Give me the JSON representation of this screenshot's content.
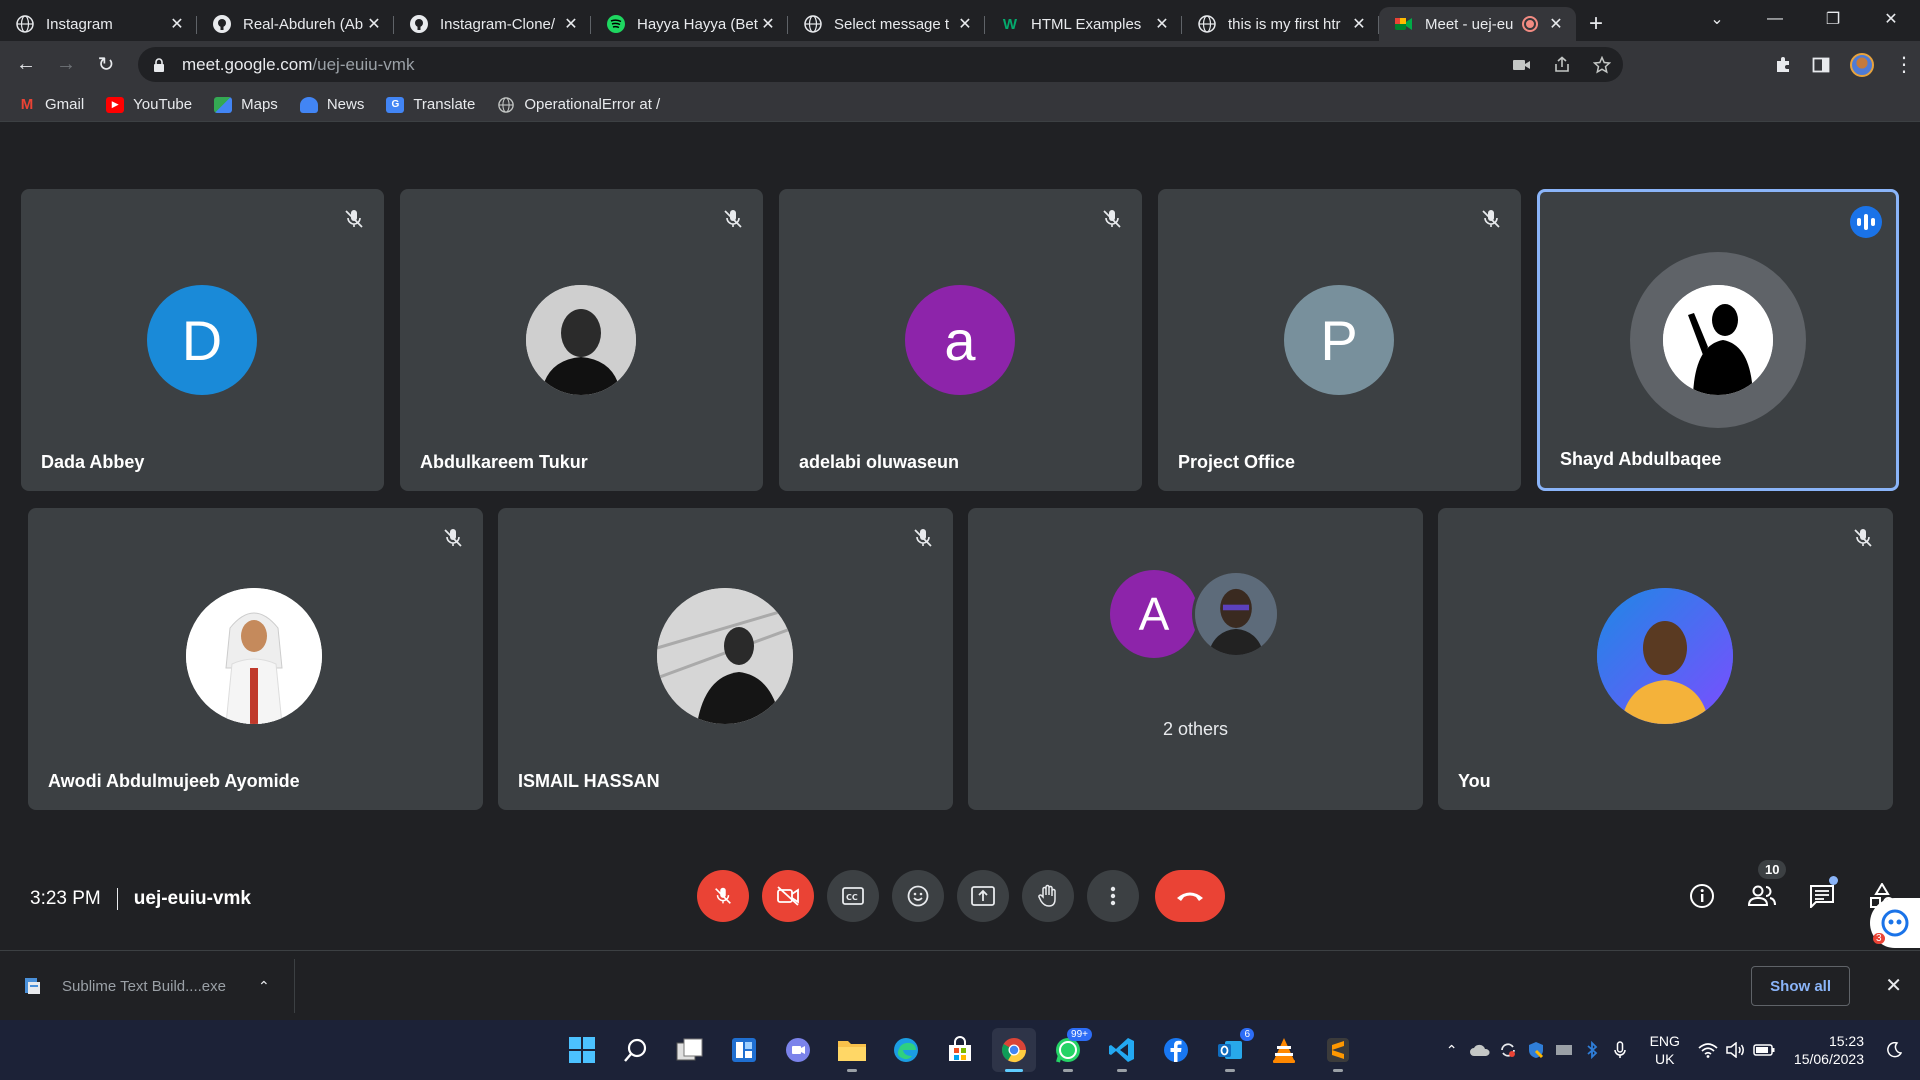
{
  "tabs": [
    {
      "title": "Instagram",
      "icon": "globe-icon"
    },
    {
      "title": "Real-Abdureh (Ab",
      "icon": "github-icon"
    },
    {
      "title": "Instagram-Clone/",
      "icon": "github-icon"
    },
    {
      "title": "Hayya Hayya (Bet",
      "icon": "spotify-icon"
    },
    {
      "title": "Select message t",
      "icon": "globe-icon"
    },
    {
      "title": "HTML Examples",
      "icon": "w3schools-icon"
    },
    {
      "title": "this is my first htr",
      "icon": "globe-icon"
    },
    {
      "title": "Meet - uej-eu",
      "icon": "google-meet-icon",
      "active": true
    }
  ],
  "address": {
    "host": "meet.google.com",
    "path": "/uej-euiu-vmk"
  },
  "bookmarks": [
    {
      "label": "Gmail",
      "icon": "gmail-icon",
      "color": "#ea4335"
    },
    {
      "label": "YouTube",
      "icon": "youtube-icon",
      "color": "#ff0000"
    },
    {
      "label": "Maps",
      "icon": "maps-icon",
      "color": "#34a853"
    },
    {
      "label": "News",
      "icon": "news-icon",
      "color": "#4285f4"
    },
    {
      "label": "Translate",
      "icon": "translate-icon",
      "color": "#4285f4"
    },
    {
      "label": "OperationalError at /",
      "icon": "globe-icon",
      "color": "#9aa0a6"
    }
  ],
  "participants": [
    {
      "name": "Dada Abbey",
      "initial": "D",
      "color": "#1a8ad8"
    },
    {
      "name": "Abdulkareem Tukur",
      "initial": "",
      "color": "#2a2a2a"
    },
    {
      "name": "adelabi oluwaseun",
      "initial": "a",
      "color": "#8d24aa"
    },
    {
      "name": "Project Office",
      "initial": "P",
      "color": "#78909c"
    },
    {
      "name": "Shayd Abdulbaqee",
      "initial": "",
      "color": "#ffffff"
    },
    {
      "name": "Awodi Abdulmujeeb Ayomide",
      "initial": "",
      "color": "#ffffff"
    },
    {
      "name": "ISMAIL HASSAN",
      "initial": "",
      "color": "#d0d0d0"
    },
    {
      "name": "2 others",
      "initial": "A",
      "color": "#8d24aa"
    },
    {
      "name": "You",
      "initial": "",
      "color": "#2979ff"
    }
  ],
  "meeting": {
    "time": "3:23 PM",
    "code": "uej-euiu-vmk",
    "people_count": "10"
  },
  "download": {
    "file": "Sublime Text Build....exe",
    "show_all": "Show all"
  },
  "taskbar": {
    "whatsapp_badge": "99+",
    "outlook_badge": "6",
    "lang_top": "ENG",
    "lang_bottom": "UK",
    "time": "15:23",
    "date": "15/06/2023"
  },
  "side_badge": "3"
}
